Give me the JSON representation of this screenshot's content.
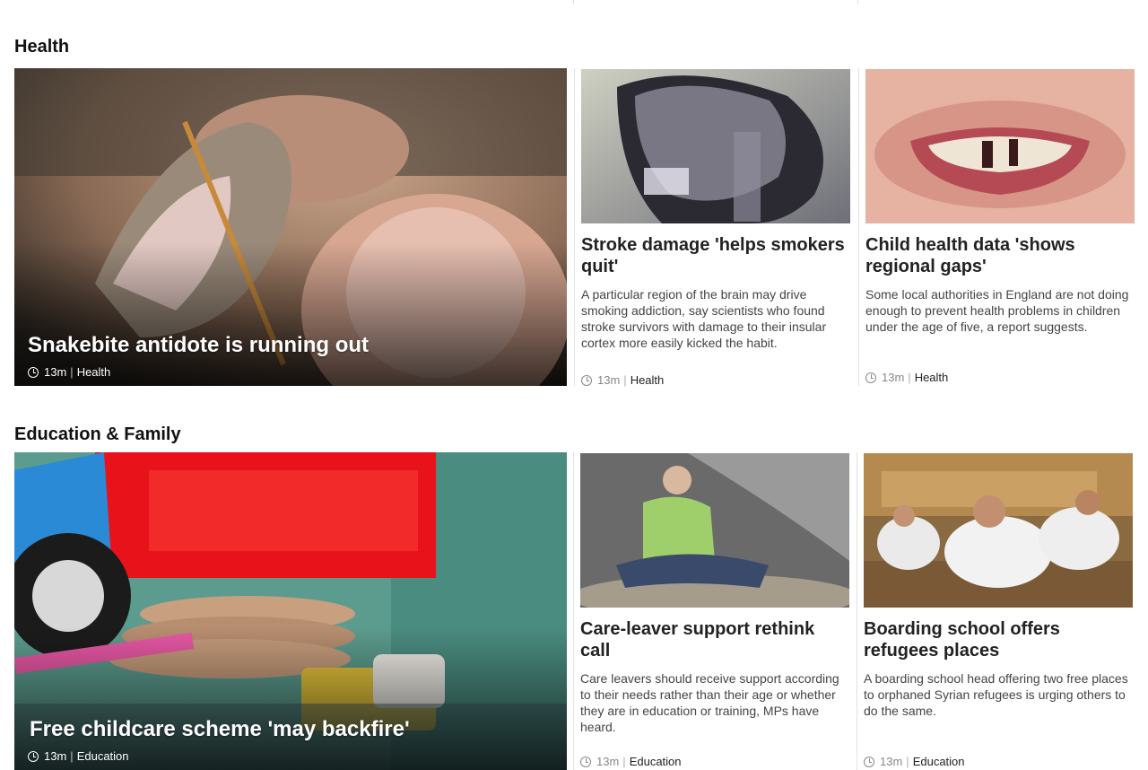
{
  "sections": [
    {
      "title": "Health",
      "lead": {
        "headline": "Snakebite antidote is running out",
        "time": "13m",
        "tag": "Health"
      },
      "cards": [
        {
          "headline": "Stroke damage 'helps smokers quit'",
          "summary": "A particular region of the brain may drive smoking addiction, say scientists who found stroke survivors with damage to their insular cortex more easily kicked the habit.",
          "time": "13m",
          "tag": "Health"
        },
        {
          "headline": "Child health data 'shows regional gaps'",
          "summary": "Some local authorities in England are not doing enough to prevent health problems in children under the age of five, a report suggests.",
          "time": "13m",
          "tag": "Health"
        }
      ]
    },
    {
      "title": "Education & Family",
      "lead": {
        "headline": "Free childcare scheme 'may backfire'",
        "time": "13m",
        "tag": "Education"
      },
      "cards": [
        {
          "headline": "Care-leaver support rethink call",
          "summary": "Care leavers should receive support according to their needs rather than their age or whether they are in education or training, MPs have heard.",
          "time": "13m",
          "tag": "Education"
        },
        {
          "headline": "Boarding school offers refugees places",
          "summary": "A boarding school head offering two free places to orphaned Syrian refugees is urging others to do the same.",
          "time": "13m",
          "tag": "Education"
        }
      ]
    }
  ],
  "separator": "|",
  "icons": {
    "timestamp": "clock-icon"
  }
}
